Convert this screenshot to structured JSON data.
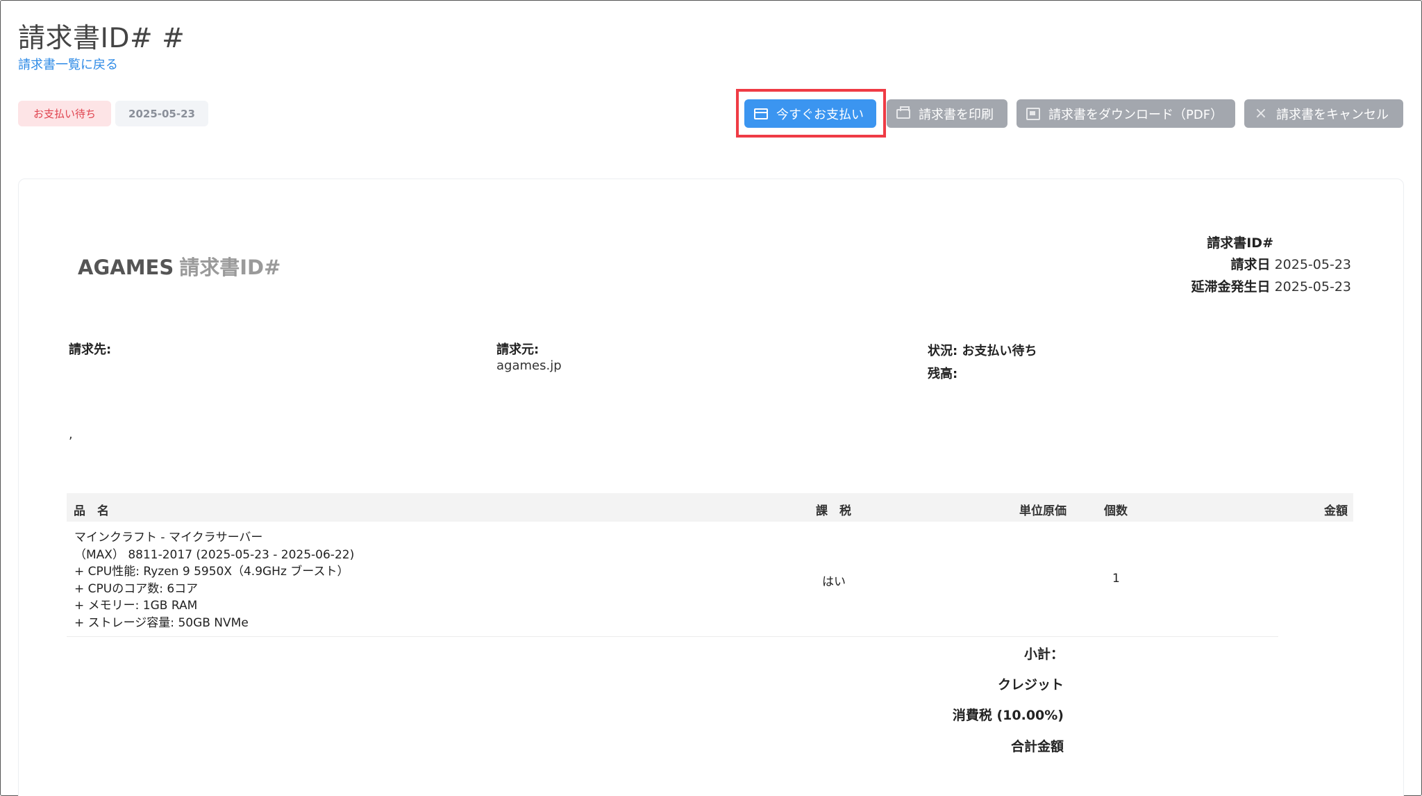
{
  "header": {
    "title": "請求書ID# #",
    "back_link": "請求書一覧に戻る"
  },
  "badges": {
    "status": "お支払い待ち",
    "date": "2025-05-23"
  },
  "actions": {
    "pay": "今すぐお支払い",
    "print": "請求書を印刷",
    "download": "請求書をダウンロード（PDF）",
    "cancel": "請求書をキャンセル"
  },
  "invoice": {
    "brand": "AGAMES",
    "brand_sub": "請求書ID#",
    "id_label": "請求書ID#",
    "date_label": "請求日",
    "date_value": "2025-05-23",
    "due_label": "延滞金発生日",
    "due_value": "2025-05-23",
    "bill_to_label": "請求先:",
    "bill_to_value": ",",
    "from_label": "請求元:",
    "from_value": "agames.jp",
    "status_label": "状況:",
    "status_value": "お支払い待ち",
    "balance_label": "残高:"
  },
  "table": {
    "columns": [
      "品　名",
      "課　税",
      "単位原価",
      "個数",
      "金額"
    ],
    "rows": [
      {
        "description": [
          "マインクラフト - マイクラサーバー",
          "（MAX） 8811-2017 (2025-05-23 - 2025-06-22)",
          "+ CPU性能: Ryzen 9 5950X（4.9GHz ブースト）",
          "+ CPUのコア数: 6コア",
          "+ メモリー: 1GB RAM",
          "+ ストレージ容量: 50GB NVMe"
        ],
        "taxed": "はい",
        "unit_price": "",
        "quantity": "1",
        "amount": ""
      }
    ]
  },
  "totals": {
    "subtotal": "小計：",
    "credit": "クレジット",
    "tax": "消費税 (10.00%)",
    "total": "合計金額"
  }
}
